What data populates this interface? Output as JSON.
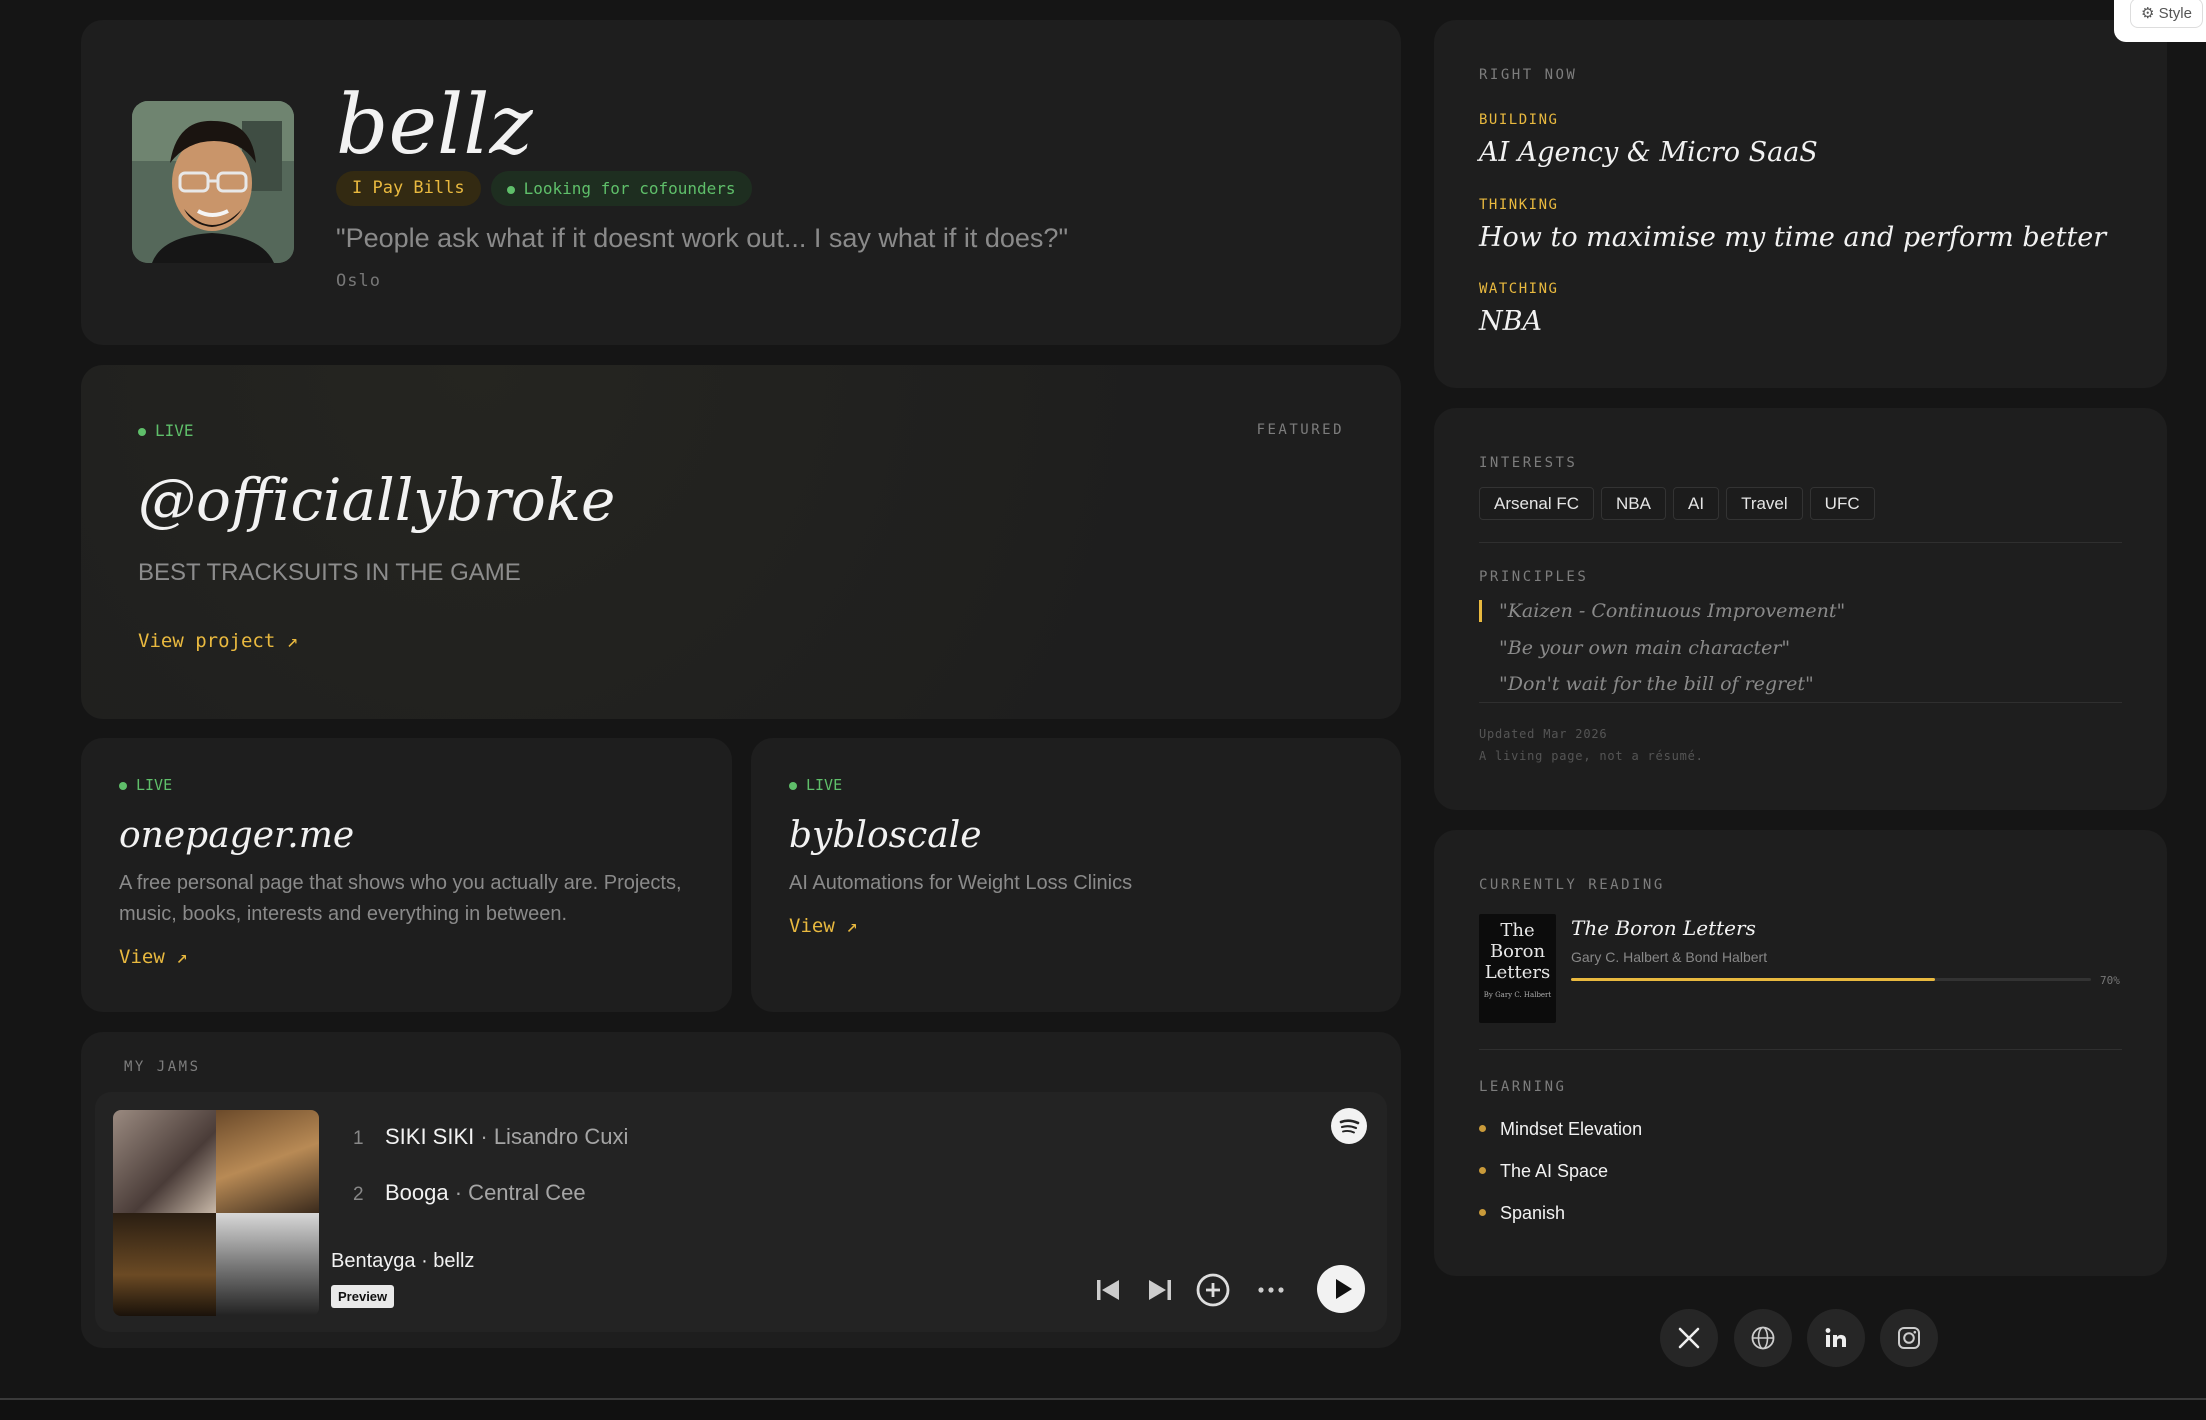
{
  "profile": {
    "name": "bellz",
    "badge_pay": "I Pay Bills",
    "badge_cofounders": "Looking for cofounders",
    "quote": "\"People ask what if it doesnt work out... I say what if it does?\"",
    "location": "Oslo"
  },
  "featured": {
    "status": "LIVE",
    "featured_label": "FEATURED",
    "title": "@officiallybroke",
    "tagline": "BEST TRACKSUITS IN THE GAME",
    "link": "View project ↗"
  },
  "projects": [
    {
      "status": "LIVE",
      "title": "onepager.me",
      "description": "A free personal page that shows who you actually are. Projects, music, books, interests and everything in between.",
      "link": "View ↗"
    },
    {
      "status": "LIVE",
      "title": "bybloscale",
      "description": "AI Automations for Weight Loss Clinics",
      "link": "View ↗"
    }
  ],
  "jams": {
    "label": "MY JAMS",
    "tracks": [
      {
        "num": "1",
        "title": "SIKI SIKI",
        "artist": " · Lisandro Cuxi"
      },
      {
        "num": "2",
        "title": "Booga",
        "artist": " · Central Cee"
      }
    ],
    "now_playing": "Bentayga · bellz",
    "preview": "Preview",
    "icons": [
      "spotify-icon",
      "skip-back-icon",
      "skip-forward-icon",
      "add-icon",
      "more-icon",
      "play-icon"
    ]
  },
  "right_now": {
    "label": "RIGHT NOW",
    "building_key": "BUILDING",
    "building": "AI Agency & Micro SaaS",
    "thinking_key": "THINKING",
    "thinking": "How to maximise my time and perform better",
    "watching_key": "WATCHING",
    "watching": "NBA"
  },
  "interests": {
    "label": "INTERESTS",
    "items": [
      "Arsenal FC",
      "NBA",
      "AI",
      "Travel",
      "UFC"
    ]
  },
  "principles": {
    "label": "PRINCIPLES",
    "items": [
      "\"Kaizen - Continuous Improvement\"",
      "\"Be your own main character\"",
      "\"Don't wait for the bill of regret\""
    ]
  },
  "footer_note": {
    "updated": "Updated Mar 2026",
    "tagline": "A living page, not a résumé."
  },
  "reading": {
    "label": "CURRENTLY READING",
    "cover_title": "The Boron Letters",
    "cover_small": "By Gary C. Halbert",
    "title": "The Boron Letters",
    "author": "Gary C. Halbert & Bond Halbert",
    "progress": 0.7,
    "progress_label": "70%"
  },
  "learning": {
    "label": "LEARNING",
    "items": [
      "Mindset Elevation",
      "The AI Space",
      "Spanish"
    ]
  },
  "social": [
    "x-icon",
    "globe-icon",
    "linkedin-icon",
    "instagram-icon"
  ],
  "style_button": "⚙ Style",
  "colors": {
    "background": "#151515",
    "card": "#1e1e1e",
    "accent": "#e9b93f",
    "live": "#5fbf6a"
  }
}
